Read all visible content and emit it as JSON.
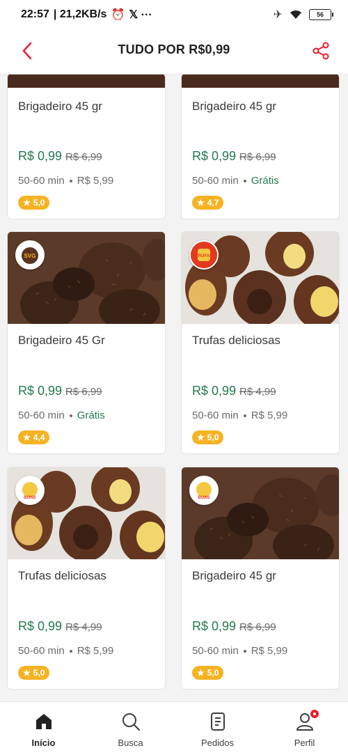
{
  "status_bar": {
    "time": "22:57",
    "network": "| 21,2KB/s",
    "extra": "𝕏 ···",
    "battery": "56"
  },
  "header": {
    "title": "TUDO POR R$0,99"
  },
  "products": [
    {
      "name": "Brigadeiro 45 gr",
      "price": "R$ 0,99",
      "old_price": "R$ 6,99",
      "time": "50-60 min",
      "fee": "R$ 5,99",
      "rating": "5,0",
      "image": "brigadeiro"
    },
    {
      "name": "Brigadeiro 45 gr",
      "price": "R$ 0,99",
      "old_price": "R$ 6,99",
      "time": "50-60 min",
      "fee": "Grátis",
      "rating": "4,7",
      "image": "brigadeiro"
    },
    {
      "name": "Brigadeiro 45 Gr",
      "price": "R$ 0,99",
      "old_price": "R$ 6,99",
      "time": "50-60 min",
      "fee": "Grátis",
      "rating": "4,4",
      "image": "brigadeiro",
      "logo": "SVG"
    },
    {
      "name": "Trufas deliciosas",
      "price": "R$ 0,99",
      "old_price": "R$ 4,99",
      "time": "50-60 min",
      "fee": "R$ 5,99",
      "rating": "5,0",
      "image": "trufas",
      "logo": "TRUFAS"
    },
    {
      "name": "Trufas deliciosas",
      "price": "R$ 0,99",
      "old_price": "R$ 4,99",
      "time": "50-60 min",
      "fee": "R$ 5,99",
      "rating": "5,0",
      "image": "trufas",
      "logo": "BONS"
    },
    {
      "name": "Brigadeiro 45 gr",
      "price": "R$ 0,99",
      "old_price": "R$ 6,99",
      "time": "50-60 min",
      "fee": "R$ 5,99",
      "rating": "5,0",
      "image": "brigadeiro",
      "logo": "BONS"
    }
  ],
  "nav": [
    {
      "label": "Início",
      "icon": "home-icon",
      "active": true
    },
    {
      "label": "Busca",
      "icon": "search-icon"
    },
    {
      "label": "Pedidos",
      "icon": "orders-icon"
    },
    {
      "label": "Perfil",
      "icon": "profile-icon",
      "badge": true
    }
  ],
  "colors": {
    "accent": "#ea1d2c",
    "price": "#237a4e",
    "rating": "#f5b324"
  }
}
